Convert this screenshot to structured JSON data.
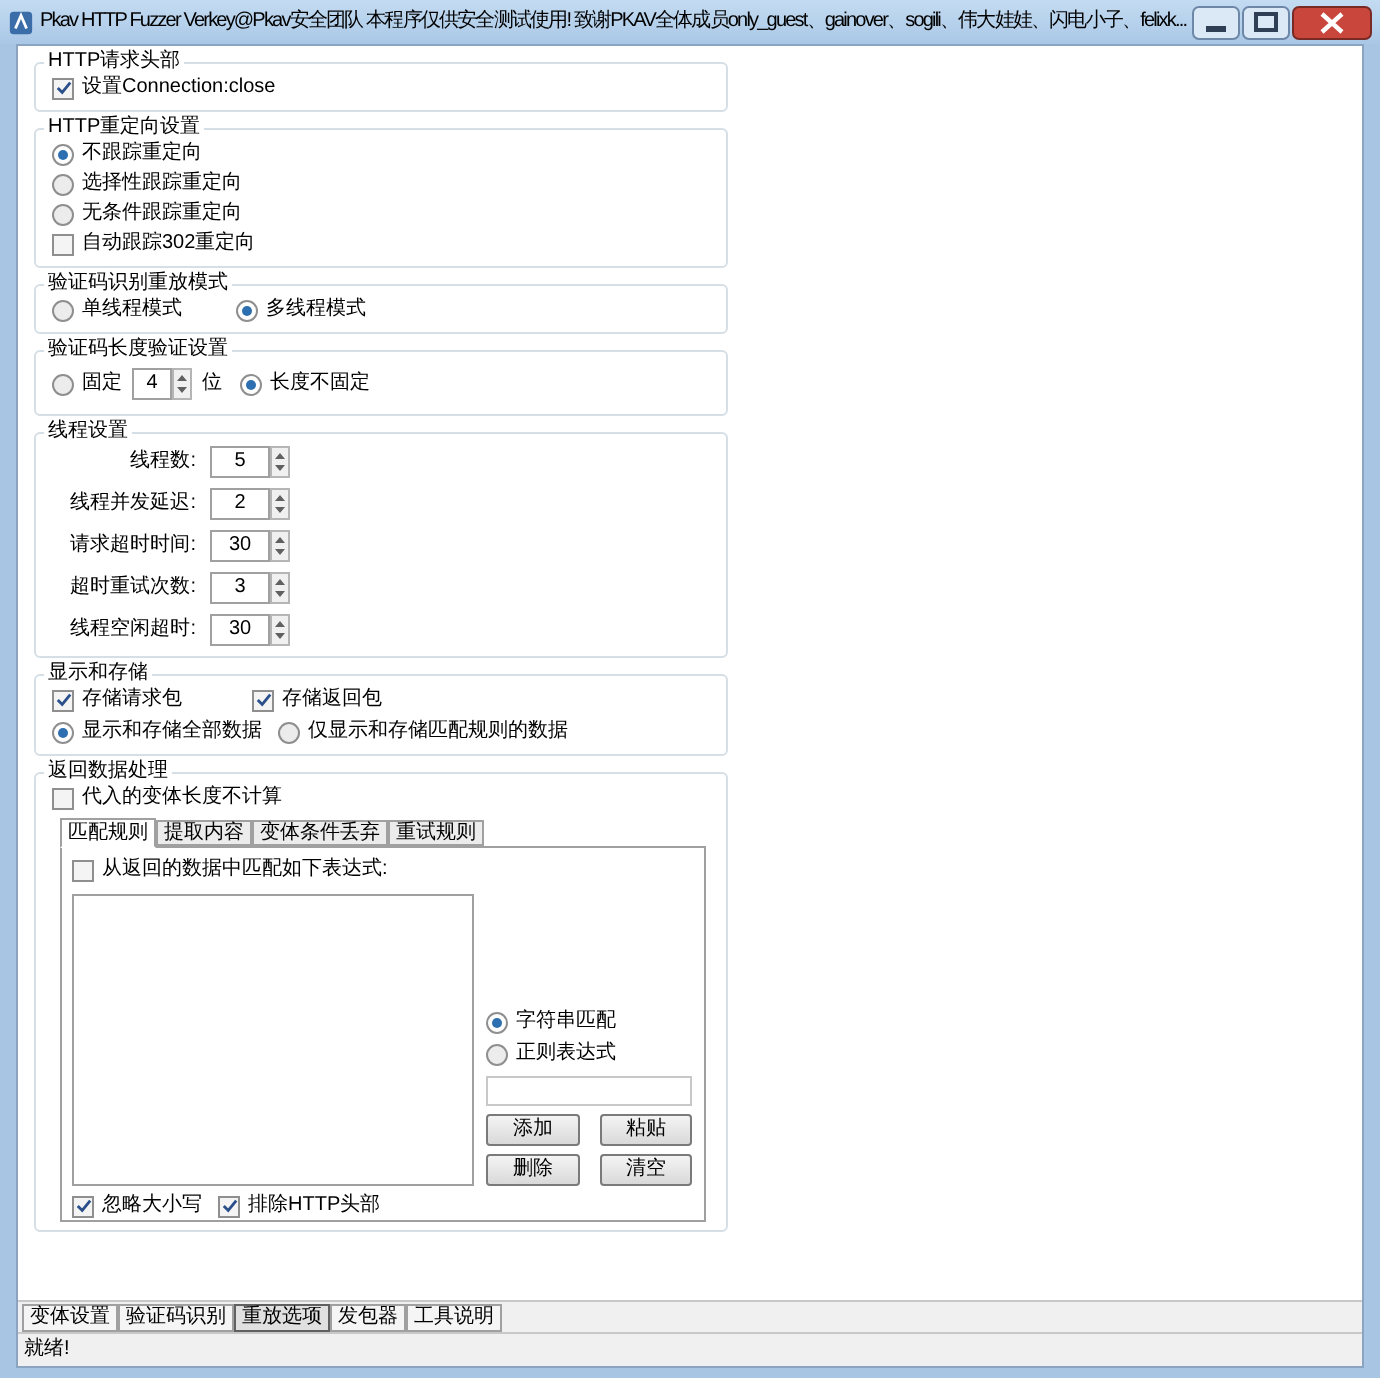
{
  "window": {
    "title": "Pkav HTTP Fuzzer  Verkey@Pkav安全团队  本程序仅供安全测试使用!  致谢PKAV全体成员only_guest、gainover、sogili、伟大娃娃、闪电小子、felixk..."
  },
  "http_header": {
    "title": "HTTP请求头部",
    "option": {
      "label": "设置Connection:close",
      "checked": true
    }
  },
  "redirect": {
    "title": "HTTP重定向设置",
    "options": [
      {
        "kind": "radio",
        "label": "不跟踪重定向",
        "selected": true
      },
      {
        "kind": "radio",
        "label": "选择性跟踪重定向",
        "selected": false
      },
      {
        "kind": "radio",
        "label": "无条件跟踪重定向",
        "selected": false
      },
      {
        "kind": "checkbox",
        "label": "自动跟踪302重定向",
        "checked": false
      }
    ]
  },
  "captcha_mode": {
    "title": "验证码识别重放模式",
    "options": [
      {
        "label": "单线程模式",
        "selected": false
      },
      {
        "label": "多线程模式",
        "selected": true
      }
    ]
  },
  "captcha_length": {
    "title": "验证码长度验证设置",
    "fixed": {
      "label": "固定",
      "selected": false,
      "value": "4",
      "unit": "位"
    },
    "variable": {
      "label": "长度不固定",
      "selected": true
    }
  },
  "threads": {
    "title": "线程设置",
    "fields": [
      {
        "label": "线程数:",
        "value": "5"
      },
      {
        "label": "线程并发延迟:",
        "value": "2"
      },
      {
        "label": "请求超时时间:",
        "value": "30"
      },
      {
        "label": "超时重试次数:",
        "value": "3"
      },
      {
        "label": "线程空闲超时:",
        "value": "30"
      }
    ]
  },
  "display": {
    "title": "显示和存储",
    "checkboxes": [
      {
        "label": "存储请求包",
        "checked": true
      },
      {
        "label": "存储返回包",
        "checked": true
      }
    ],
    "radios": [
      {
        "label": "显示和存储全部数据",
        "selected": true
      },
      {
        "label": "仅显示和存储匹配规则的数据",
        "selected": false
      }
    ]
  },
  "response": {
    "title": "返回数据处理",
    "exclude_length": {
      "label": "代入的变体长度不计算",
      "checked": false
    },
    "tabs": [
      {
        "label": "匹配规则",
        "selected": true
      },
      {
        "label": "提取内容",
        "selected": false
      },
      {
        "label": "变体条件丢弃",
        "selected": false
      },
      {
        "label": "重试规则",
        "selected": false
      }
    ],
    "match": {
      "label": "从返回的数据中匹配如下表达式:",
      "checked": false
    },
    "match_mode": [
      {
        "label": "字符串匹配",
        "selected": true
      },
      {
        "label": "正则表达式",
        "selected": false
      }
    ],
    "buttons": [
      "添加",
      "粘贴",
      "删除",
      "清空"
    ],
    "bottom_checkboxes": [
      {
        "label": "忽略大小写",
        "checked": true
      },
      {
        "label": "排除HTTP头部",
        "checked": true
      }
    ]
  },
  "bottom_tabs": [
    {
      "label": "变体设置",
      "selected": false
    },
    {
      "label": "验证码识别",
      "selected": false
    },
    {
      "label": "重放选项",
      "selected": true
    },
    {
      "label": "发包器",
      "selected": false
    },
    {
      "label": "工具说明",
      "selected": false
    }
  ],
  "status_bar": "就绪!"
}
